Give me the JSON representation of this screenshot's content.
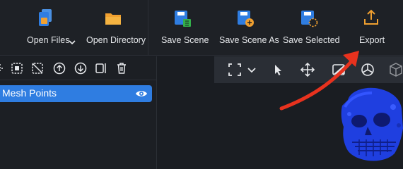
{
  "toolbar": {
    "open_files": "Open Files",
    "open_directory": "Open Directory",
    "save_scene": "Save Scene",
    "save_scene_as": "Save Scene As",
    "save_selected": "Save Selected",
    "export": "Export"
  },
  "scene_tree": {
    "items": [
      {
        "label": "Mesh Points",
        "selected": true,
        "visible": true
      }
    ]
  },
  "icons": {
    "panel_tools": [
      "select-all-icon",
      "select-box-icon",
      "deselect-icon",
      "move-up-icon",
      "move-down-icon",
      "split-icon",
      "delete-icon"
    ],
    "view_tools": [
      "fit-view-icon",
      "chevron-down-icon",
      "pointer-icon",
      "move-icon",
      "surface-icon",
      "sphere-icon",
      "cube-icon"
    ]
  },
  "colors": {
    "accent_blue": "#2f7de1",
    "folder_orange": "#f0a030",
    "mesh_blue": "#1f3fe0",
    "annotation_red": "#e8321e",
    "save_green": "#33b04a",
    "save_orange": "#f0a030"
  }
}
